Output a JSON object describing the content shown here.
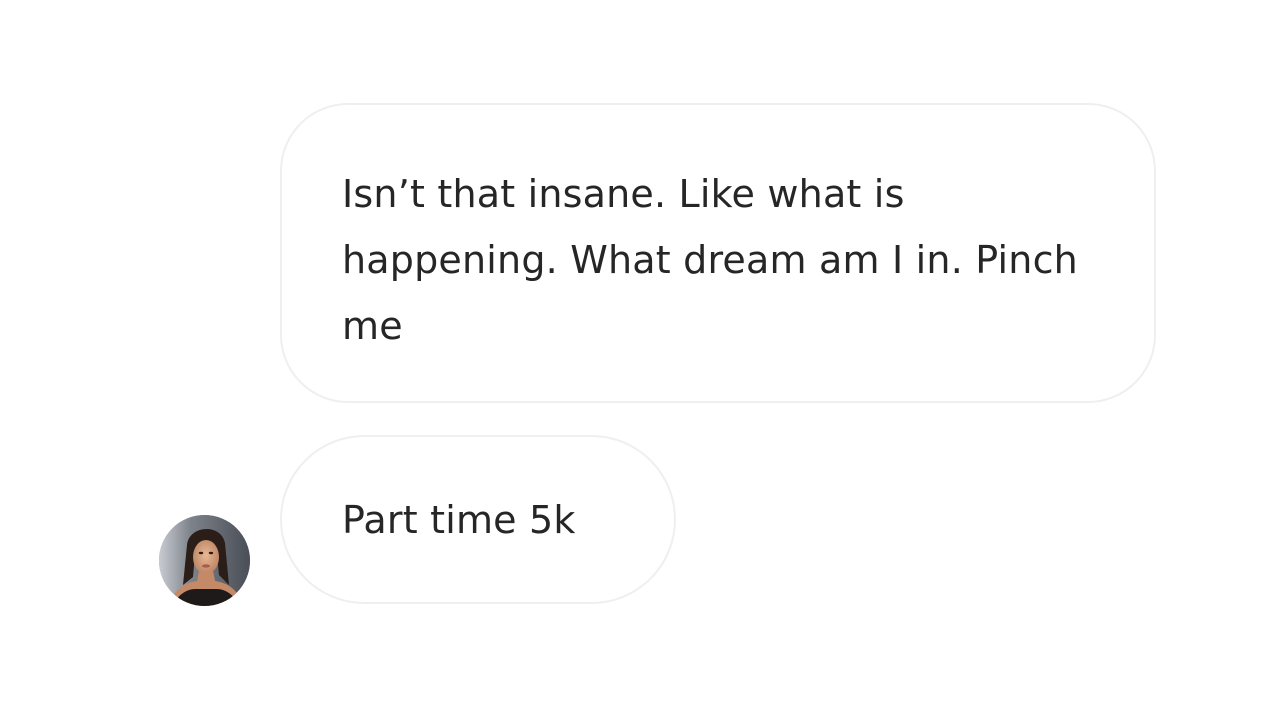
{
  "messages": [
    {
      "text": "Isn’t that insane. Like what is happening. What dream am I in. Pinch me"
    },
    {
      "text": "Part time 5k"
    }
  ],
  "avatar": {
    "icon": "profile-photo"
  },
  "colors": {
    "bubble_border": "#efefef",
    "bubble_background": "#ffffff",
    "text": "#262626",
    "page_background": "#ffffff"
  }
}
